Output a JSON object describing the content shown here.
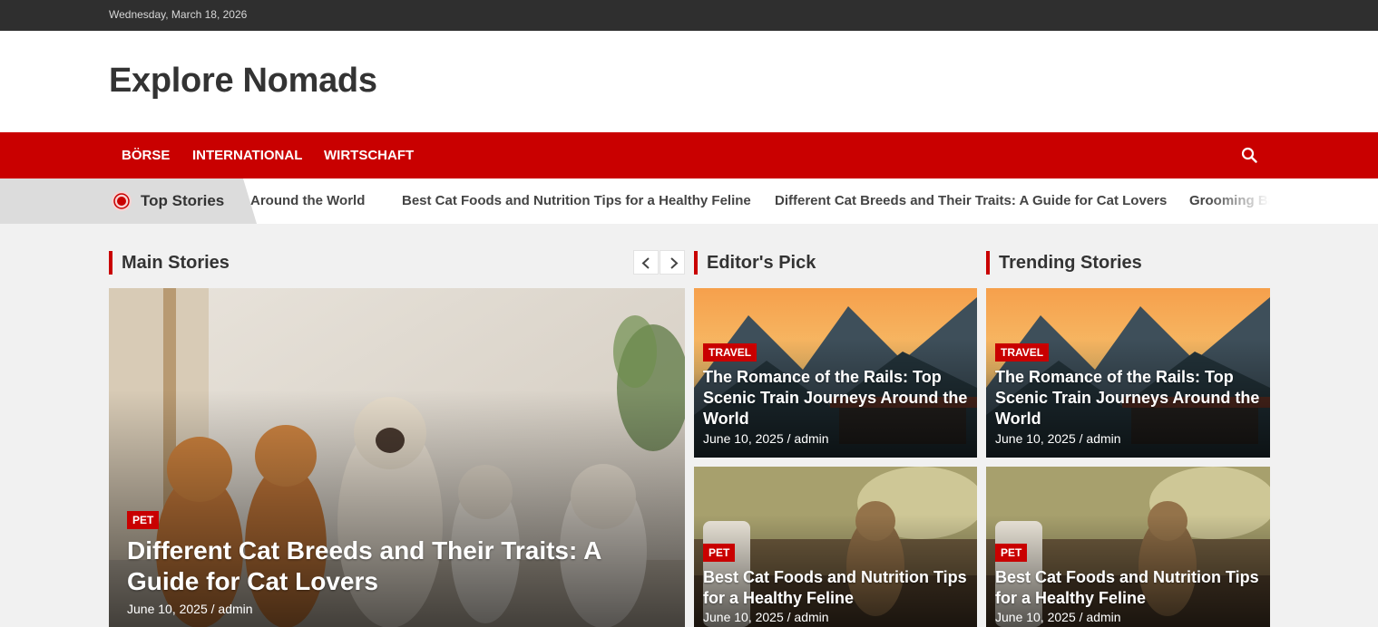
{
  "topbar": {
    "date": "Wednesday, March 18, 2026"
  },
  "header": {
    "site_title": "Explore Nomads"
  },
  "nav": {
    "items": [
      "BÖRSE",
      "INTERNATIONAL",
      "WIRTSCHAFT"
    ],
    "search_icon": "search-icon"
  },
  "ticker": {
    "label": "Top Stories",
    "items": [
      "Around the World",
      "Best Cat Foods and Nutrition Tips for a Healthy Feline",
      "Different Cat Breeds and Their Traits: A Guide for Cat Lovers",
      "Grooming Ba"
    ]
  },
  "sections": {
    "main": "Main Stories",
    "editors": "Editor's Pick",
    "trending": "Trending Stories"
  },
  "main_story": {
    "category": "PET",
    "title": "Different Cat Breeds and Their Traits: A Guide for Cat Lovers",
    "meta": "June 10, 2025 / admin"
  },
  "editors_pick": [
    {
      "category": "TRAVEL",
      "title": "The Romance of the Rails: Top Scenic Train Journeys Around the World",
      "meta": "June 10, 2025 / admin"
    },
    {
      "category": "PET",
      "title": "Best Cat Foods and Nutrition Tips for a Healthy Feline",
      "meta": "June 10, 2025 / admin"
    }
  ],
  "trending": [
    {
      "category": "TRAVEL",
      "title": "The Romance of the Rails: Top Scenic Train Journeys Around the World",
      "meta": "June 10, 2025 / admin"
    },
    {
      "category": "PET",
      "title": "Best Cat Foods and Nutrition Tips for a Healthy Feline",
      "meta": "June 10, 2025 / admin"
    }
  ],
  "colors": {
    "accent": "#c90000",
    "topbar": "#2f2f2f",
    "background": "#f1f1f1"
  }
}
